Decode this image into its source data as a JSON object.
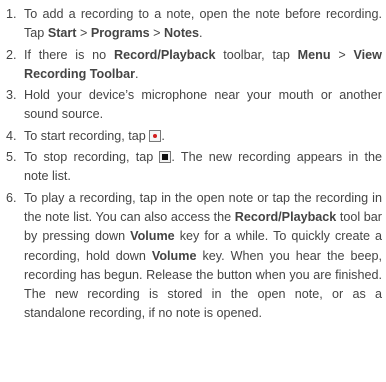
{
  "steps": [
    {
      "num": "1.",
      "t1": "To add a recording to a note, open the note before recording. Tap ",
      "b1": "Start",
      "t2": " > ",
      "b2": "Programs",
      "t3": " > ",
      "b3": "Notes",
      "t4": "."
    },
    {
      "num": "2.",
      "t1": "If there is no ",
      "b1": "Record/Playback",
      "t2": " toolbar, tap ",
      "b2": "Menu",
      "t3": " > ",
      "b3": "View Recording Toolbar",
      "t4": "."
    },
    {
      "num": "3.",
      "t1": "Hold your device’s microphone near your mouth or another sound source."
    },
    {
      "num": "4.",
      "t1": "To start recording, tap ",
      "icon": "record-icon",
      "t2": "."
    },
    {
      "num": "5.",
      "t1": "To stop recording, tap ",
      "icon": "stop-icon",
      "t2": ". The new recording appears in the note list."
    },
    {
      "num": "6.",
      "t1": "To play a recording, tap in the open note or tap the recording in the note list. You can also access the ",
      "b1": "Record/Playback",
      "t2": " tool bar by pressing down ",
      "b2": "Volume",
      "t3": " key for a while. To quickly create a recording, hold down ",
      "b3": "Volume",
      "t4": " key. When you hear the beep, recording has begun. Release the button when you are finished. The new recording is stored in the open note, or as a standalone recording, if no note is opened."
    }
  ]
}
